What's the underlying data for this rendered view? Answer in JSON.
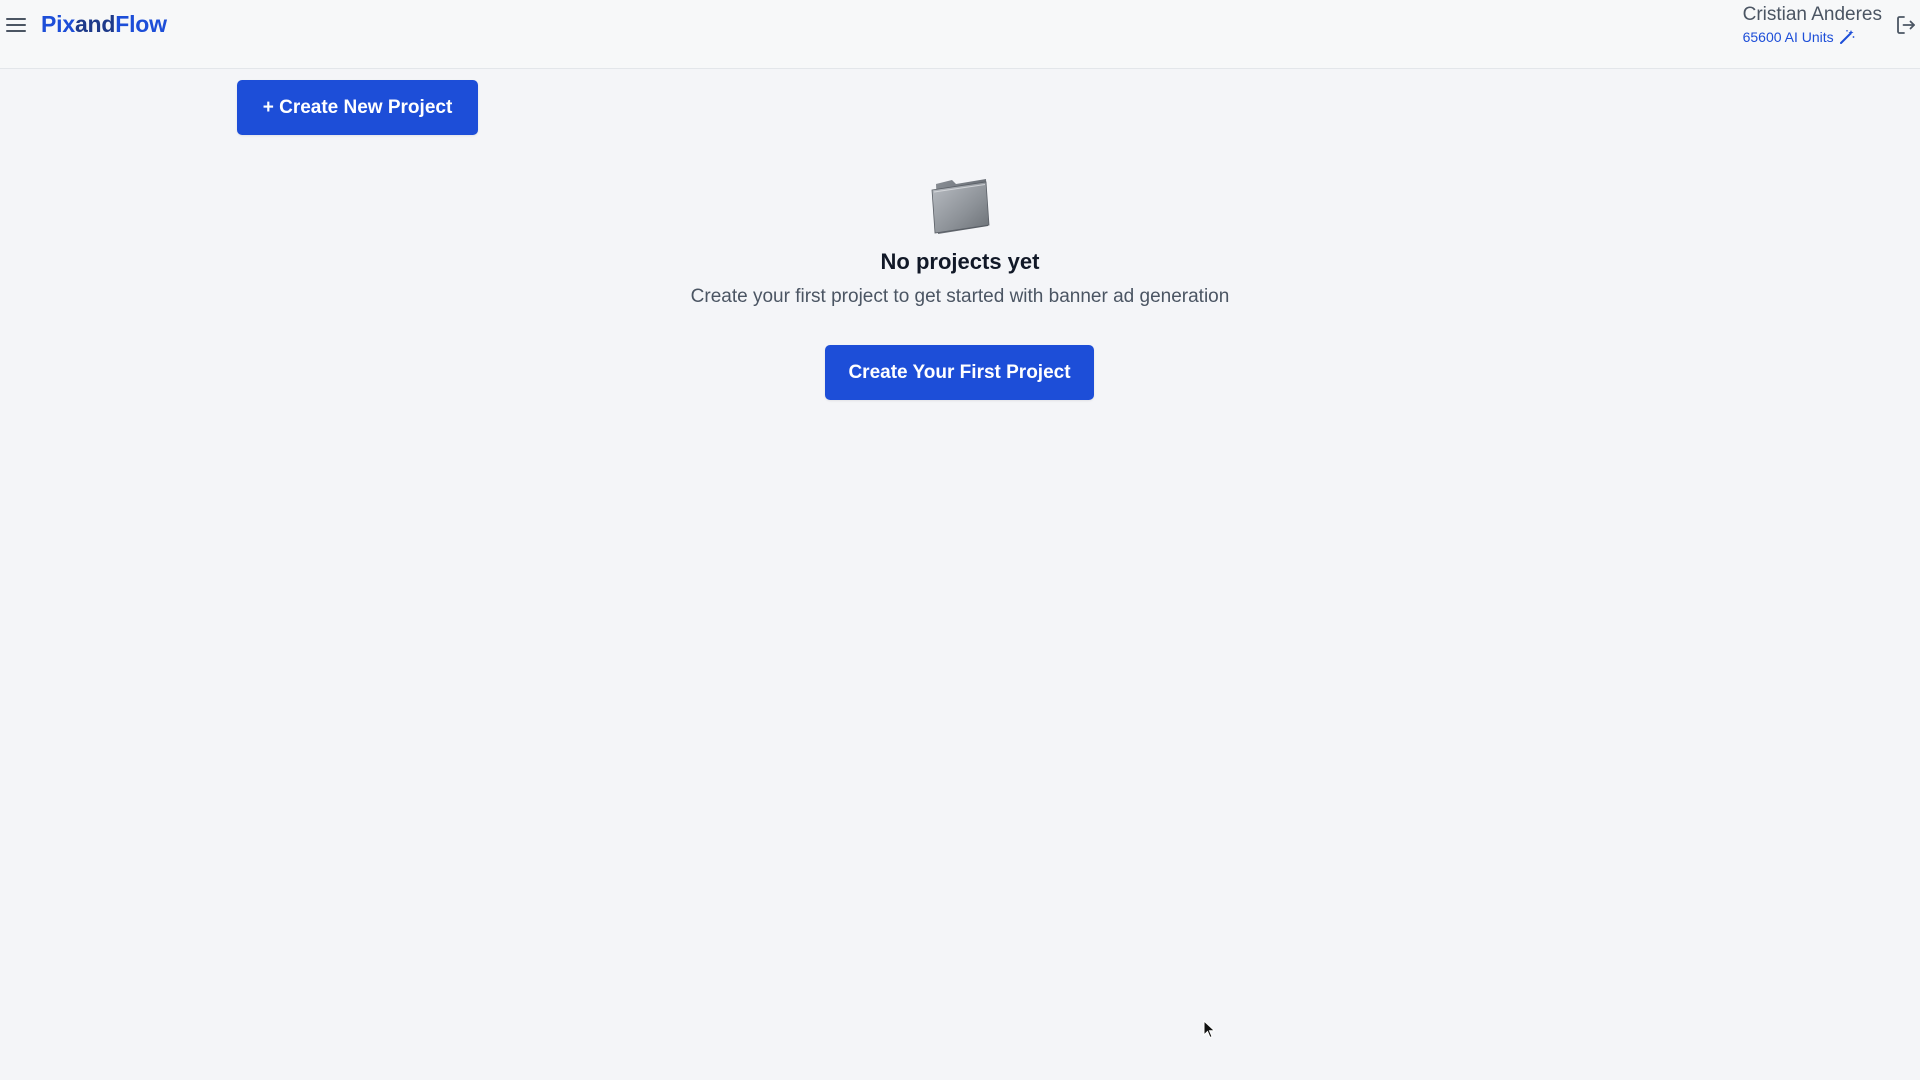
{
  "header": {
    "brand": {
      "pix": "Pix",
      "and": "and",
      "flow": "Flow"
    },
    "menu_icon": "hamburger-menu-icon",
    "user": {
      "name": "Cristian Anderes",
      "units": "65600 AI Units",
      "units_icon": "magic-wand-icon"
    },
    "logout_icon": "logout-icon"
  },
  "toolbar": {
    "create_new_label": "+ Create New Project"
  },
  "empty_state": {
    "icon": "folder-icon",
    "title": "No projects yet",
    "description": "Create your first project to get started with banner ad generation",
    "cta_label": "Create Your First Project"
  },
  "colors": {
    "primary": "#1d4ed8",
    "background": "#f4f5f8",
    "header_bg": "#f7f8f9",
    "text_muted": "#4b5563"
  }
}
